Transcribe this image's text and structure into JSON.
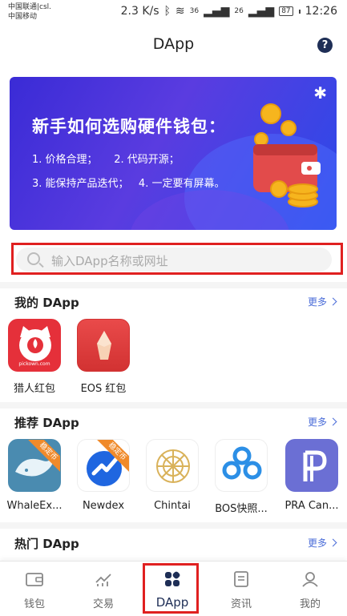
{
  "status_bar": {
    "carrier_line1": "中国联通|csl.",
    "carrier_line2": "中国移动",
    "net_speed": "2.3 K/s",
    "signal1": "36",
    "signal2": "26",
    "battery": "87",
    "time": "12:26"
  },
  "header": {
    "title": "DApp",
    "help_glyph": "?"
  },
  "banner": {
    "title": "新手如何选购硬件钱包：",
    "line1": "1. 价格合理；     2. 代码开源；",
    "line2": "3. 能保持产品迭代；   4. 一定要有屏幕。"
  },
  "search": {
    "placeholder": "输入DApp名称或网址"
  },
  "sections": {
    "mine": {
      "title": "我的 DApp",
      "more": "更多"
    },
    "recommended": {
      "title": "推荐 DApp",
      "more": "更多"
    },
    "hot": {
      "title": "热门 DApp",
      "more": "更多"
    }
  },
  "my_dapps": [
    {
      "label": "猎人红包",
      "icon": "cat-hunter-icon",
      "caption": "pickown.com"
    },
    {
      "label": "EOS 红包",
      "icon": "red-envelope-icon"
    }
  ],
  "recommended_dapps": [
    {
      "label": "WhaleEx...",
      "icon": "whale-icon",
      "badge": "稳定币"
    },
    {
      "label": "Newdex",
      "icon": "newdex-icon",
      "badge": "稳定币"
    },
    {
      "label": "Chintai",
      "icon": "chintai-icon"
    },
    {
      "label": "BOS快照...",
      "icon": "bos-icon"
    },
    {
      "label": "PRA Can...",
      "icon": "pra-icon"
    }
  ],
  "bottom_nav": [
    {
      "label": "钱包",
      "icon": "wallet-icon"
    },
    {
      "label": "交易",
      "icon": "chart-icon"
    },
    {
      "label": "DApp",
      "icon": "grid-icon",
      "active": true
    },
    {
      "label": "资讯",
      "icon": "news-icon"
    },
    {
      "label": "我的",
      "icon": "profile-icon"
    }
  ],
  "colors": {
    "accent": "#4a6cd8",
    "nav_active": "#1e2e56",
    "highlight": "#e02020"
  }
}
